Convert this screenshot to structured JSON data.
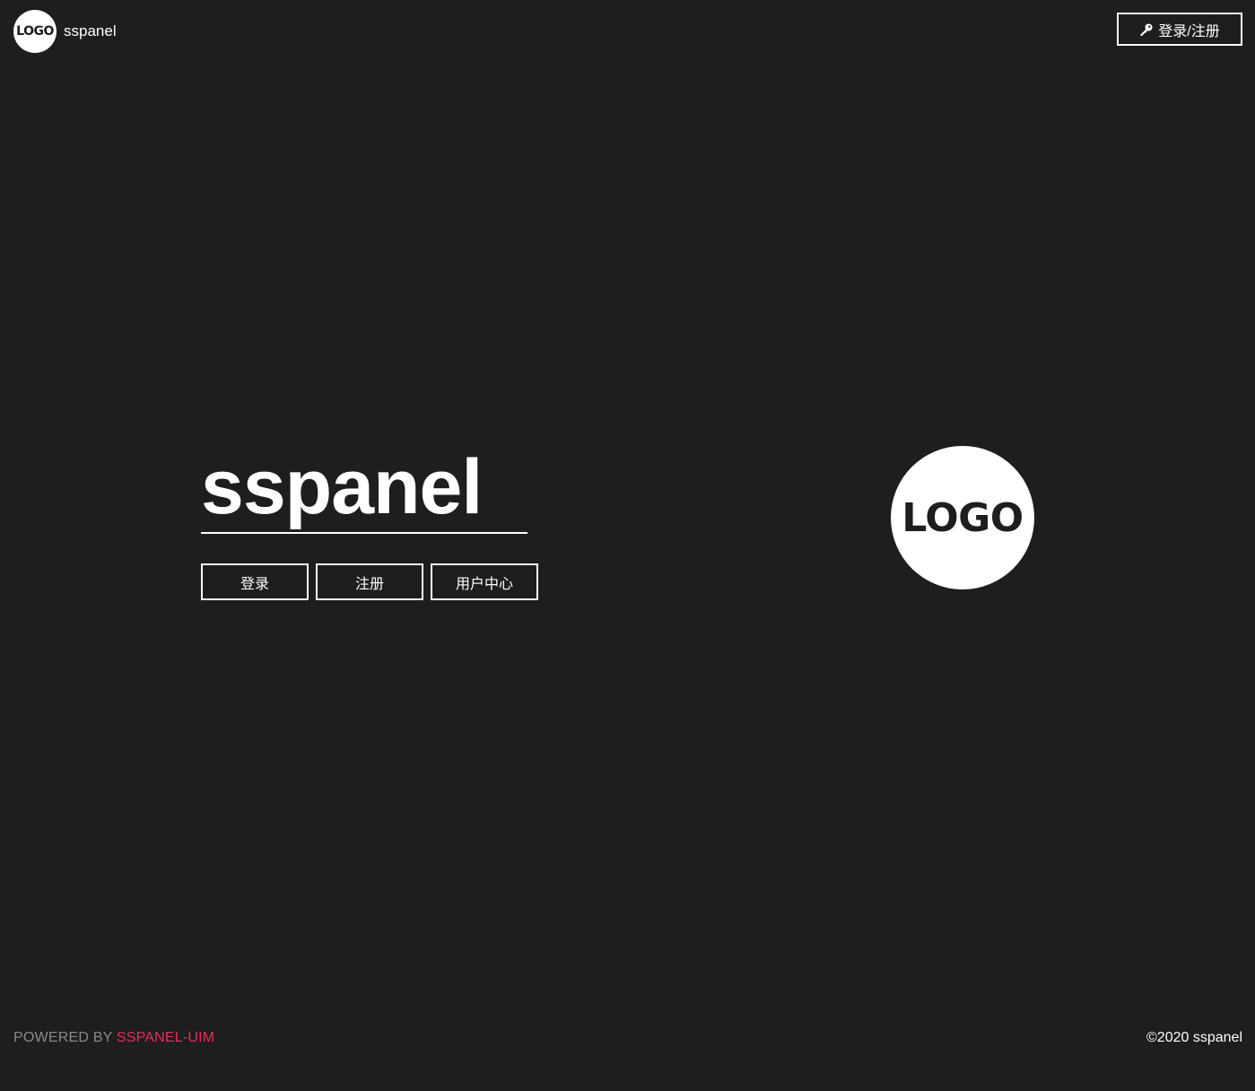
{
  "header": {
    "logo_text": "LOGO",
    "brand_name": "sspanel",
    "login_label": "登录/注册",
    "login_icon": "key-icon"
  },
  "hero": {
    "title": "sspanel",
    "buttons": [
      {
        "label": "登录"
      },
      {
        "label": "注册"
      },
      {
        "label": "用户中心"
      }
    ],
    "logo_text": "LOGO"
  },
  "footer": {
    "powered_prefix": "POWERED BY ",
    "powered_link": "SSPANEL-UIM",
    "copyright": "©2020 sspanel"
  },
  "colors": {
    "background": "#1e1e1e",
    "accent": "#e0315a",
    "muted": "#8a8a8a"
  }
}
